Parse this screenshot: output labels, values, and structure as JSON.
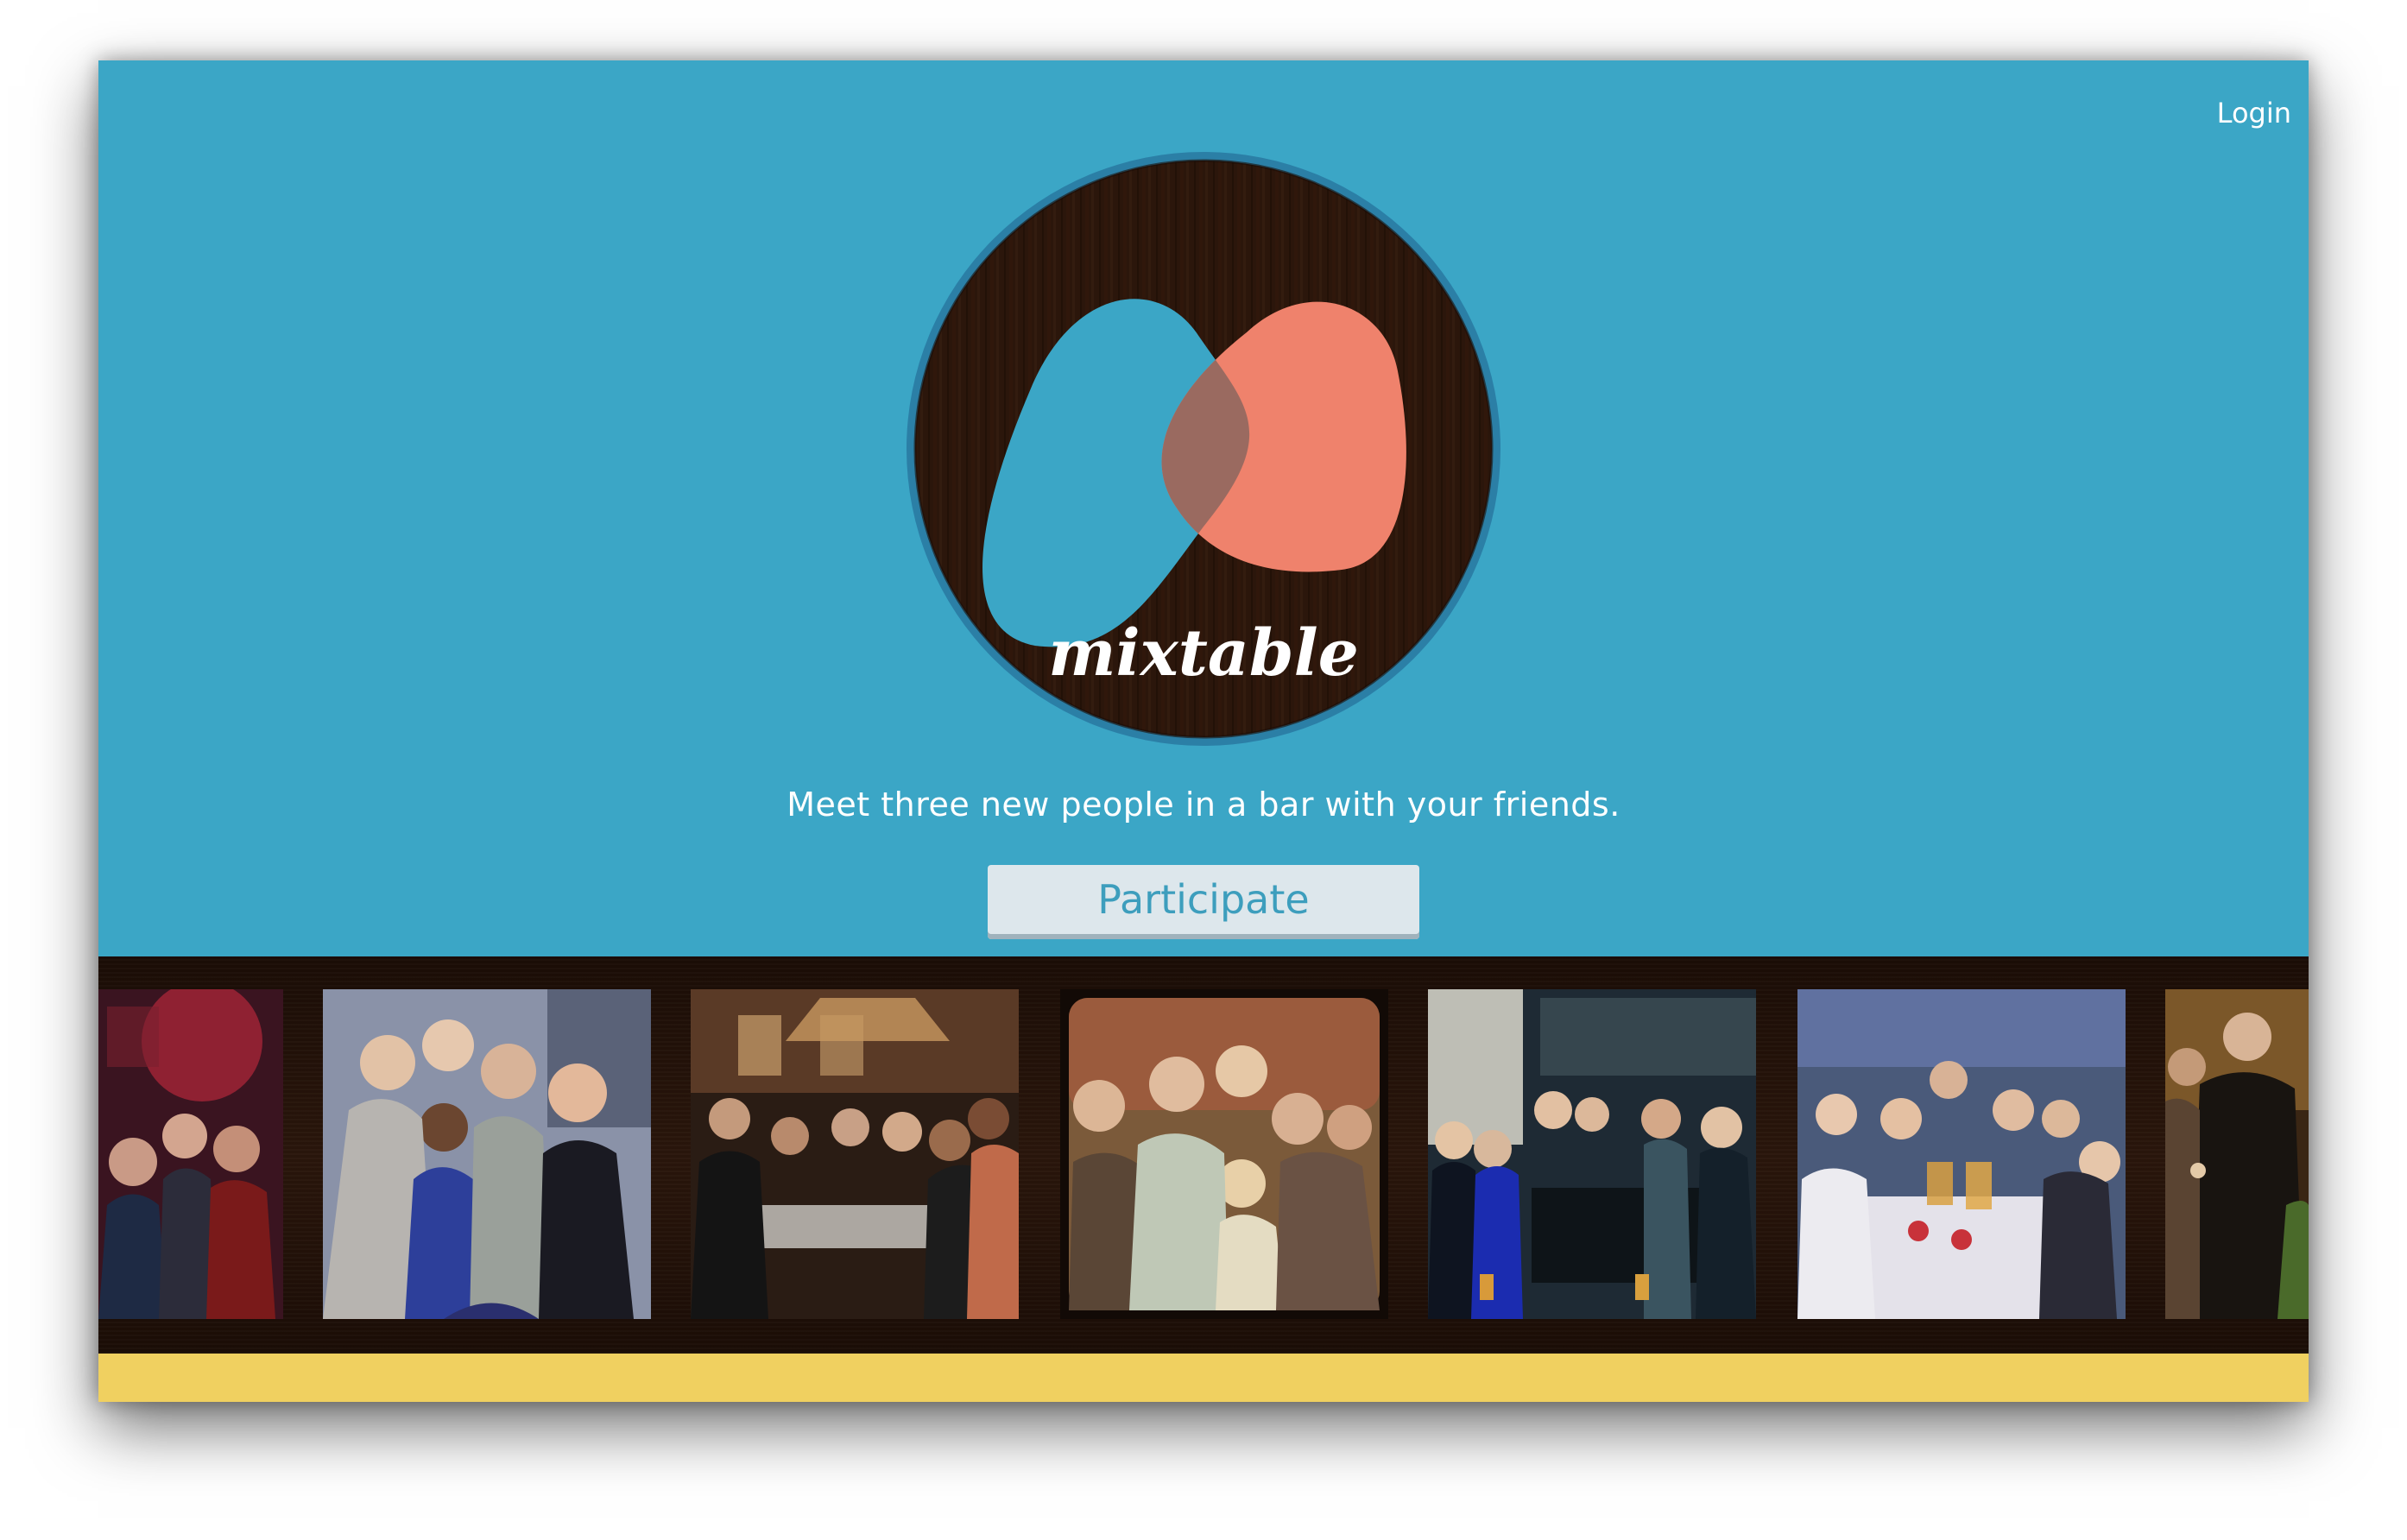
{
  "header": {
    "login_label": "Login"
  },
  "logo": {
    "wordmark": "mixtable",
    "icon": "mixtable-logo-icon"
  },
  "hero": {
    "tagline": "Meet three new people in a bar with your friends.",
    "cta_label": "Participate"
  },
  "photo_strip": {
    "photos": [
      {
        "icon": "bar-group-photo-icon"
      },
      {
        "icon": "bar-group-photo-icon"
      },
      {
        "icon": "bar-group-photo-icon"
      },
      {
        "icon": "bar-group-photo-icon"
      },
      {
        "icon": "bar-group-photo-icon"
      },
      {
        "icon": "bar-group-photo-icon"
      },
      {
        "icon": "bar-group-photo-icon"
      }
    ]
  },
  "colors": {
    "background": "#3ba6c6",
    "accent_blue": "#3ba6c6",
    "accent_salmon": "#ef826c",
    "wood_dark": "#2a160b",
    "footer_yellow": "#f0d060",
    "button_bg": "#dde7ec",
    "button_text": "#3d9ebd"
  }
}
